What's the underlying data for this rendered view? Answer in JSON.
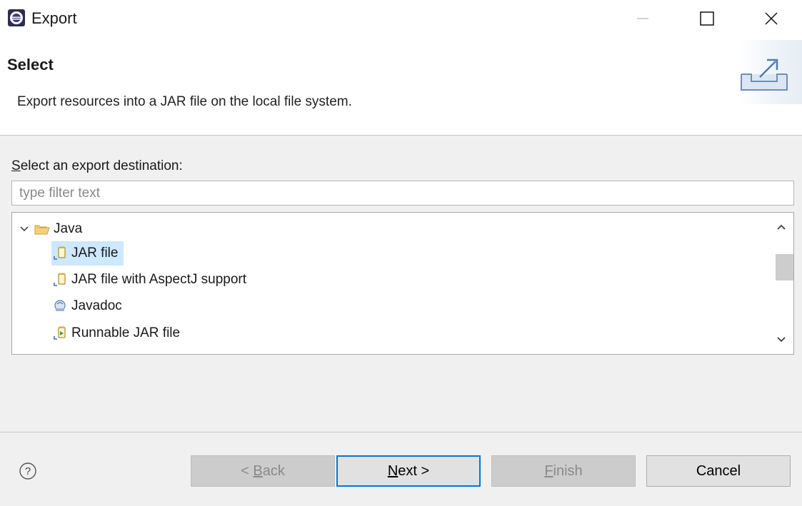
{
  "window": {
    "title": "Export",
    "controls": [
      "minimize",
      "maximize",
      "close"
    ]
  },
  "header": {
    "title": "Select",
    "description": "Export resources into a JAR file on the local file system."
  },
  "content": {
    "label_mnemonic": "S",
    "label_rest": "elect an export destination:",
    "filter_placeholder": "type filter text",
    "tree": {
      "category": {
        "label": "Java",
        "expanded": true,
        "icon": "folder-open-icon"
      },
      "items": [
        {
          "label": "JAR file",
          "selected": true,
          "icon": "jar-icon"
        },
        {
          "label": "JAR file with AspectJ support",
          "selected": false,
          "icon": "jar-icon"
        },
        {
          "label": "Javadoc",
          "selected": false,
          "icon": "javadoc-icon"
        },
        {
          "label": "Runnable JAR file",
          "selected": false,
          "icon": "runnable-jar-icon"
        }
      ]
    }
  },
  "footer": {
    "back": {
      "pre": "< ",
      "mnemonic": "B",
      "rest": "ack",
      "enabled": false
    },
    "next": {
      "mnemonic": "N",
      "rest": "ext >",
      "enabled": true
    },
    "finish": {
      "mnemonic": "F",
      "rest": "inish",
      "enabled": false
    },
    "cancel": {
      "label": "Cancel",
      "enabled": true
    }
  },
  "colors": {
    "selection": "#cde8ff",
    "default_button_border": "#0078d7",
    "panel_background": "#f0f0f0"
  }
}
